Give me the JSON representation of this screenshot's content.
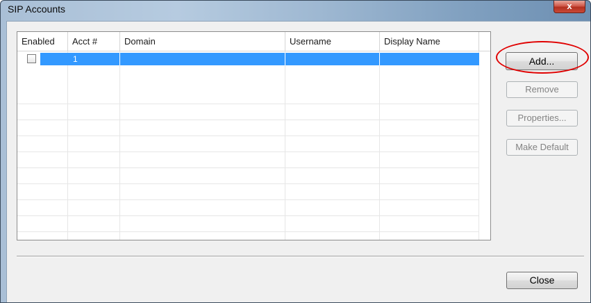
{
  "window": {
    "title": "SIP Accounts",
    "close_glyph": "x"
  },
  "table": {
    "columns": [
      "Enabled",
      "Acct #",
      "Domain",
      "Username",
      "Display Name"
    ],
    "rows": [
      {
        "enabled": false,
        "acct": "1",
        "domain": "",
        "username": "",
        "display_name": ""
      }
    ],
    "selection_color": "#3399ff"
  },
  "buttons": {
    "add": "Add...",
    "remove": "Remove",
    "properties": "Properties...",
    "make_default": "Make Default",
    "close": "Close"
  },
  "annotation": {
    "highlight_color": "#e00000",
    "highlighted": "add"
  }
}
